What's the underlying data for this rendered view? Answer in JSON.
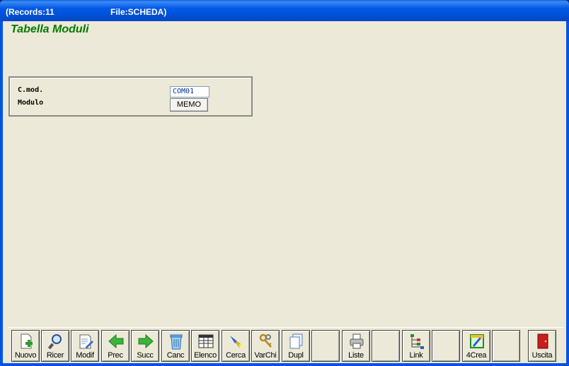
{
  "window": {
    "records": "(Records:11",
    "file": "File:SCHEDA)"
  },
  "page": {
    "title": "Tabella Moduli"
  },
  "form": {
    "cmod_label": "C.mod.",
    "cmod_value": "COM01",
    "modulo_label": "Modulo",
    "memo_label": "MEMO"
  },
  "toolbar": {
    "nuovo": "Nuovo",
    "ricer": "Ricer",
    "modif": "Modif",
    "prec": "Prec",
    "succ": "Succ",
    "canc": "Canc",
    "elenco": "Elenco",
    "cerca": "Cerca",
    "varchi": "VarChi",
    "dupl": "Dupl",
    "liste": "Liste",
    "link": "Link",
    "crea": "4Crea",
    "uscita": "Uscita"
  },
  "colors": {
    "title_green": "#007b00",
    "field_text": "#003399",
    "client_bg": "#ece9d8"
  }
}
